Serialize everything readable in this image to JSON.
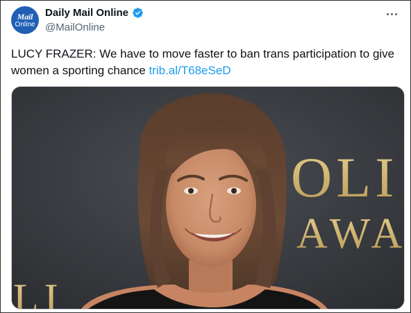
{
  "author": {
    "avatar_line1": "Mail",
    "avatar_line2": "Online",
    "display_name": "Daily Mail Online",
    "handle": "@MailOnline",
    "verified": true
  },
  "tweet": {
    "text": "LUCY FRAZER: We have to move faster to ban trans participation to give women a sporting chance",
    "link": "trib.al/T68eSeD"
  },
  "media": {
    "background_letters": [
      "OLI",
      "AWA",
      "LI"
    ]
  },
  "icons": {
    "verified": "verified-badge-icon",
    "more": "more-options-icon"
  },
  "colors": {
    "link": "#1d9bf0",
    "verified": "#1d9bf0",
    "avatar": "#1f5fb4"
  }
}
